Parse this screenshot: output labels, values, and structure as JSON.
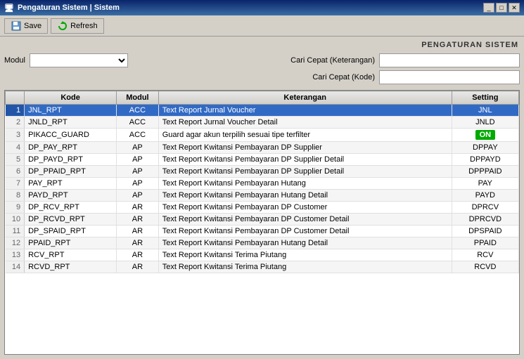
{
  "titleBar": {
    "title": "Pengaturan Sistem | Sistem",
    "icon": "🖥"
  },
  "toolbar": {
    "save_label": "Save",
    "refresh_label": "Refresh"
  },
  "header": {
    "label": "PENGATURAN SISTEM"
  },
  "filters": {
    "modul_label": "Modul",
    "cari_cepat_ket_label": "Cari Cepat (Keterangan)",
    "cari_cepat_kode_label": "Cari Cepat (Kode)",
    "modul_value": "",
    "cari_cepat_ket_value": "",
    "cari_cepat_kode_value": ""
  },
  "table": {
    "columns": [
      "Kode",
      "Modul",
      "Keterangan",
      "Setting"
    ],
    "rows": [
      {
        "num": 1,
        "kode": "JNL_RPT",
        "modul": "ACC",
        "keterangan": "Text Report Jurnal Voucher",
        "setting": "JNL",
        "selected": true,
        "toggle": false
      },
      {
        "num": 2,
        "kode": "JNLD_RPT",
        "modul": "ACC",
        "keterangan": "Text Report Jurnal Voucher Detail",
        "setting": "JNLD",
        "selected": false,
        "toggle": false
      },
      {
        "num": 3,
        "kode": "PIKACC_GUARD",
        "modul": "ACC",
        "keterangan": "Guard agar akun terpilih sesuai tipe terfilter",
        "setting": "ON",
        "selected": false,
        "toggle": true
      },
      {
        "num": 4,
        "kode": "DP_PAY_RPT",
        "modul": "AP",
        "keterangan": "Text Report Kwitansi Pembayaran DP Supplier",
        "setting": "DPPAY",
        "selected": false,
        "toggle": false
      },
      {
        "num": 5,
        "kode": "DP_PAYD_RPT",
        "modul": "AP",
        "keterangan": "Text Report Kwitansi Pembayaran DP Supplier Detail",
        "setting": "DPPAYD",
        "selected": false,
        "toggle": false
      },
      {
        "num": 6,
        "kode": "DP_PPAID_RPT",
        "modul": "AP",
        "keterangan": "Text Report Kwitansi Pembayaran DP Supplier Detail",
        "setting": "DPPPAID",
        "selected": false,
        "toggle": false
      },
      {
        "num": 7,
        "kode": "PAY_RPT",
        "modul": "AP",
        "keterangan": "Text Report Kwitansi Pembayaran Hutang",
        "setting": "PAY",
        "selected": false,
        "toggle": false
      },
      {
        "num": 8,
        "kode": "PAYD_RPT",
        "modul": "AP",
        "keterangan": "Text Report Kwitansi Pembayaran Hutang Detail",
        "setting": "PAYD",
        "selected": false,
        "toggle": false
      },
      {
        "num": 9,
        "kode": "DP_RCV_RPT",
        "modul": "AR",
        "keterangan": "Text Report Kwitansi Pembayaran DP Customer",
        "setting": "DPRCV",
        "selected": false,
        "toggle": false
      },
      {
        "num": 10,
        "kode": "DP_RCVD_RPT",
        "modul": "AR",
        "keterangan": "Text Report Kwitansi Pembayaran DP Customer Detail",
        "setting": "DPRCVD",
        "selected": false,
        "toggle": false
      },
      {
        "num": 11,
        "kode": "DP_SPAID_RPT",
        "modul": "AR",
        "keterangan": "Text Report Kwitansi Pembayaran DP Customer Detail",
        "setting": "DPSPAID",
        "selected": false,
        "toggle": false
      },
      {
        "num": 12,
        "kode": "PPAID_RPT",
        "modul": "AR",
        "keterangan": "Text Report Kwitansi Pembayaran Hutang Detail",
        "setting": "PPAID",
        "selected": false,
        "toggle": false
      },
      {
        "num": 13,
        "kode": "RCV_RPT",
        "modul": "AR",
        "keterangan": "Text Report Kwitansi Terima Piutang",
        "setting": "RCV",
        "selected": false,
        "toggle": false
      },
      {
        "num": 14,
        "kode": "RCVD_RPT",
        "modul": "AR",
        "keterangan": "Text Report Kwitansi Terima Piutang",
        "setting": "RCVD",
        "selected": false,
        "toggle": false
      }
    ]
  }
}
